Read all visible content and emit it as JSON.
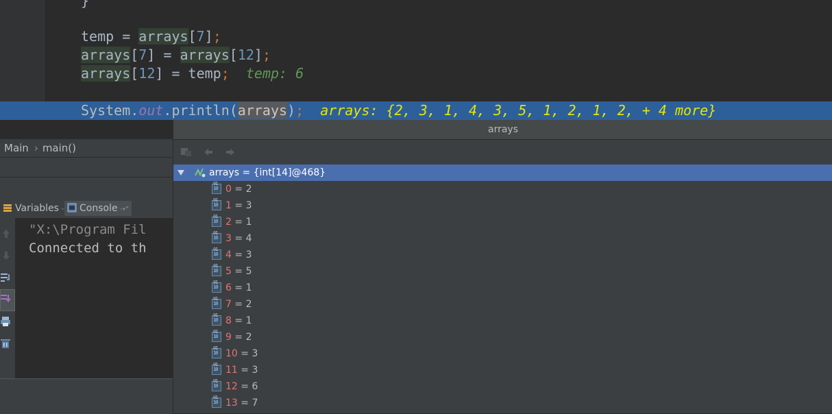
{
  "editor": {
    "line0": "}",
    "line1": {
      "p1": "temp = ",
      "p2": "arrays",
      "p3": "[",
      "p4": "7",
      "p5": "]",
      "p6": ";"
    },
    "line2": {
      "p1": "arrays",
      "p2": "[",
      "p3": "7",
      "p4": "] = ",
      "p5": "arrays",
      "p6": "[",
      "p7": "12",
      "p8": "]",
      "p9": ";"
    },
    "line3": {
      "p1": "arrays",
      "p2": "[",
      "p3": "12",
      "p4": "] = temp",
      "p5": ";",
      "inline": "temp: 6"
    },
    "exec_line": {
      "p1": "System.",
      "p2": "out",
      "p3": ".println(",
      "p4": "arrays",
      "p5": ")",
      "p6": ";",
      "inline": "arrays: {2, 3, 1, 4, 3, 5, 1, 2, 1, 2, + 4 more}"
    }
  },
  "breadcrumbs": {
    "class": "Main",
    "method": "main()"
  },
  "tabs": {
    "variables": "Variables",
    "console": "Console"
  },
  "console": {
    "line1": "\"X:\\Program Fil",
    "line2": "Connected to th"
  },
  "popup": {
    "title": "arrays",
    "root": "arrays = {int[14]@468}",
    "items": [
      {
        "index": "0",
        "value": "2"
      },
      {
        "index": "1",
        "value": "3"
      },
      {
        "index": "2",
        "value": "1"
      },
      {
        "index": "3",
        "value": "4"
      },
      {
        "index": "4",
        "value": "3"
      },
      {
        "index": "5",
        "value": "5"
      },
      {
        "index": "6",
        "value": "1"
      },
      {
        "index": "7",
        "value": "2"
      },
      {
        "index": "8",
        "value": "1"
      },
      {
        "index": "9",
        "value": "2"
      },
      {
        "index": "10",
        "value": "3"
      },
      {
        "index": "11",
        "value": "3"
      },
      {
        "index": "12",
        "value": "6"
      },
      {
        "index": "13",
        "value": "7"
      }
    ]
  },
  "colors": {
    "selection": "#4b6eaf",
    "exec_line": "#2d5f9a",
    "index": "#e37474",
    "inline_yellow": "#e6e600"
  }
}
